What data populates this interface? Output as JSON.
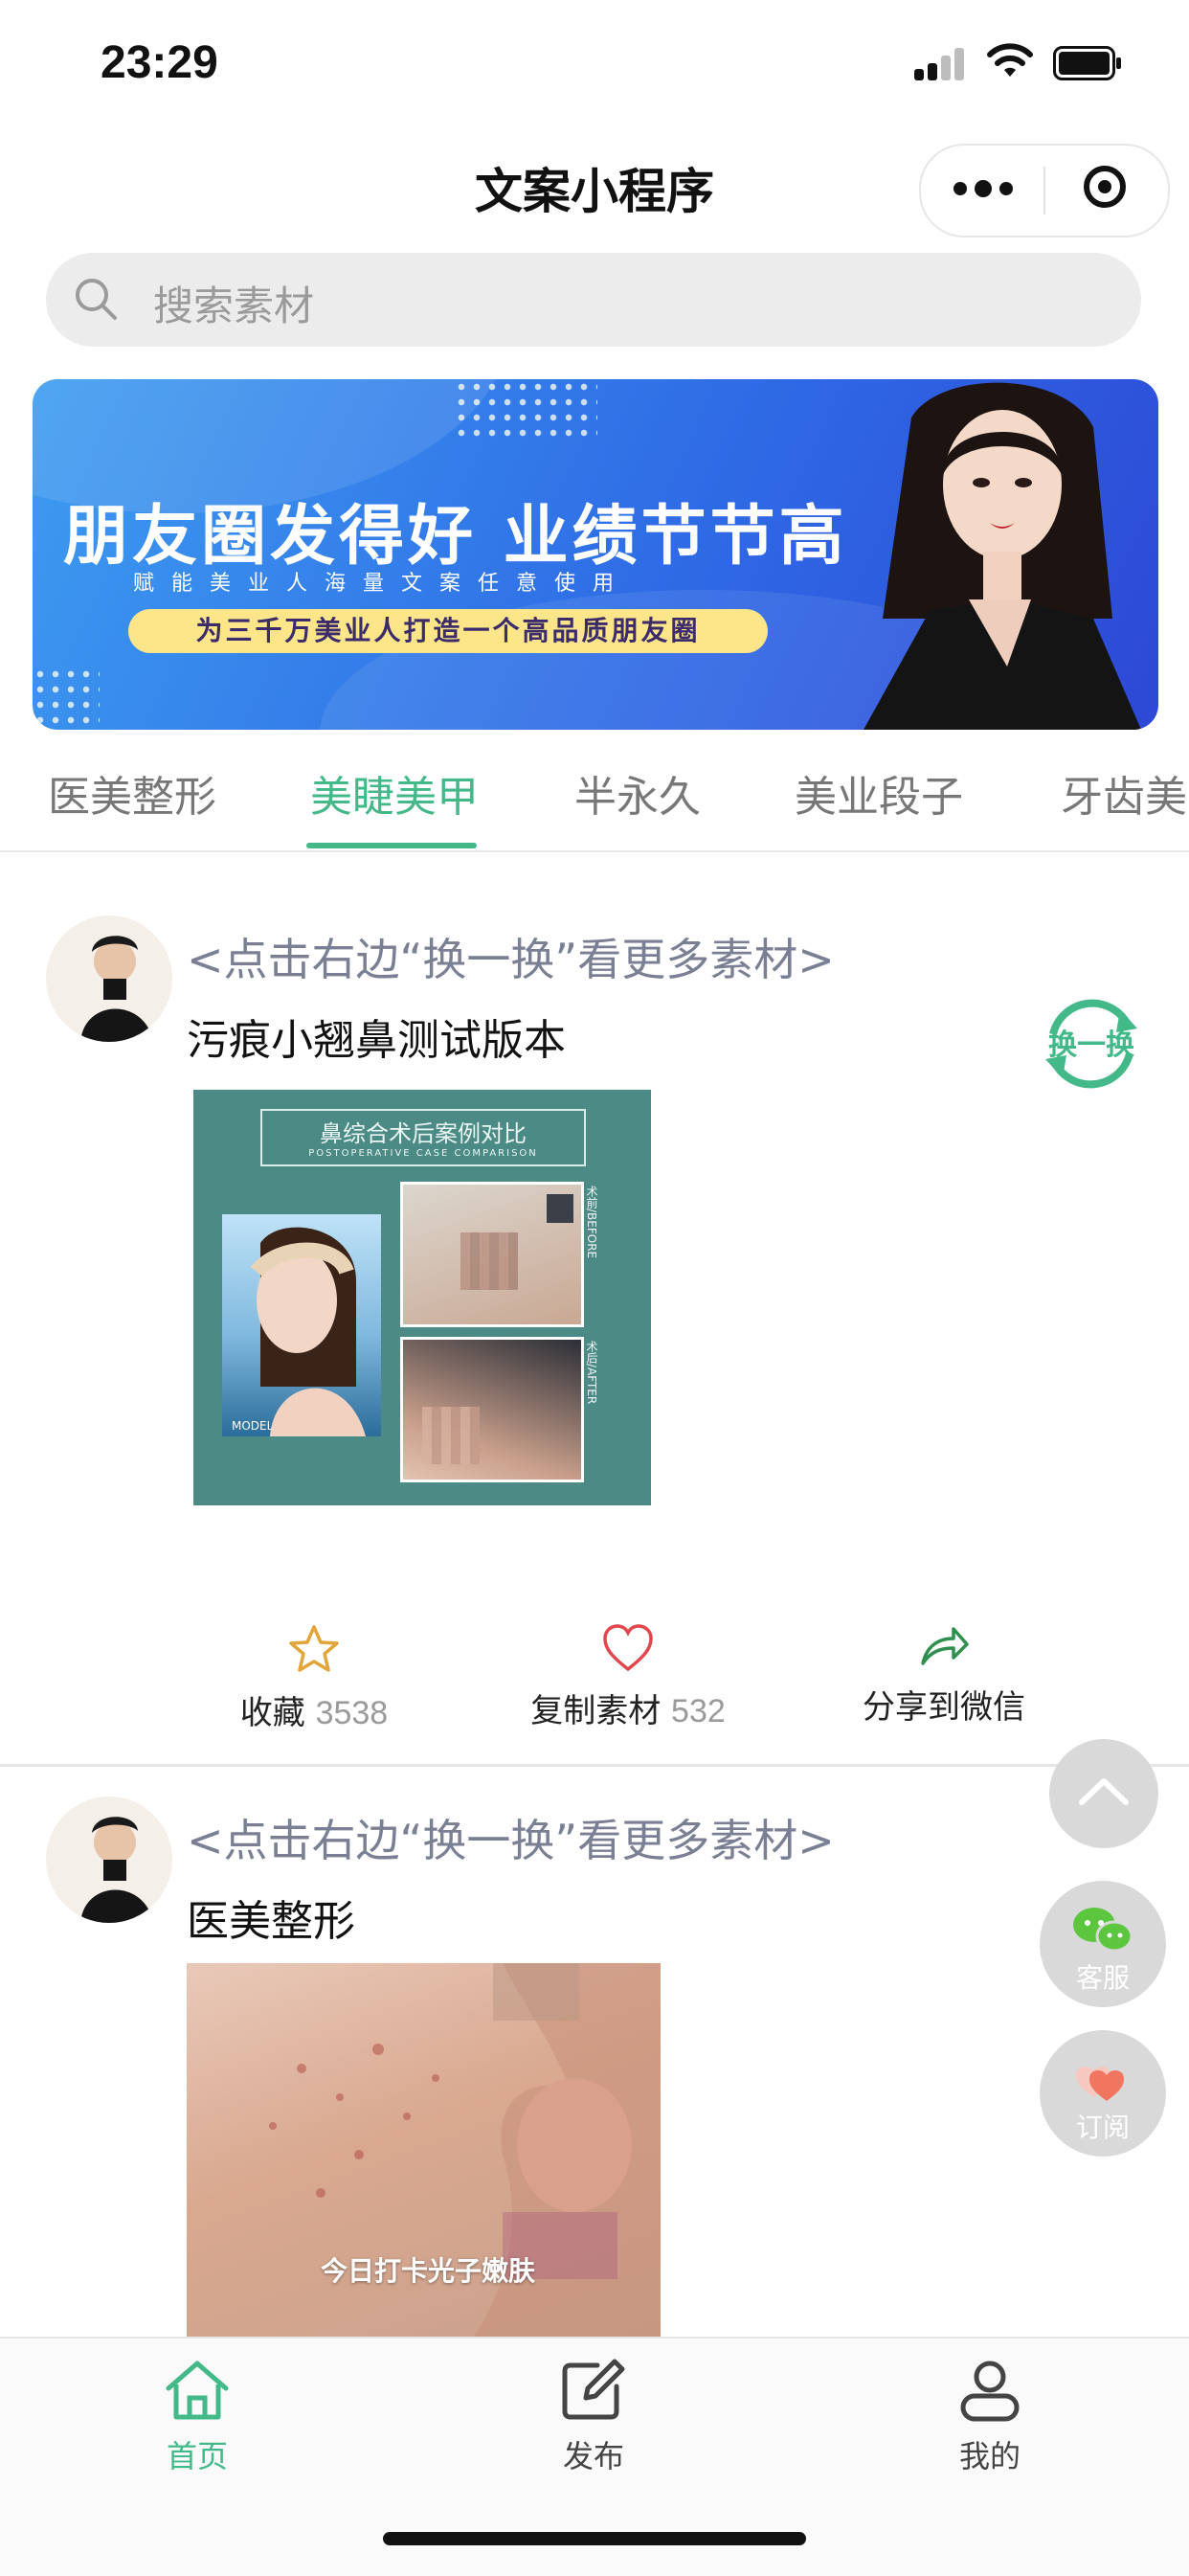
{
  "status_bar": {
    "time": "23:29"
  },
  "nav": {
    "title": "文案小程序"
  },
  "search": {
    "placeholder": "搜索素材"
  },
  "banner": {
    "headline": "朋友圈发得好  业绩节节高",
    "subline": "赋能美业人海量文案任意使用",
    "pill": "为三千万美业人打造一个高品质朋友圈"
  },
  "tabs": [
    {
      "label": "医美整形",
      "active": false
    },
    {
      "label": "美睫美甲",
      "active": true
    },
    {
      "label": "半永久",
      "active": false
    },
    {
      "label": "美业段子",
      "active": false
    },
    {
      "label": "牙齿美",
      "active": false
    }
  ],
  "posts": [
    {
      "hint": "<点击右边“换一换”看更多素材>",
      "title": "污痕小翘鼻测试版本",
      "image": {
        "header": "鼻综合术后案例对比",
        "header_en": "POSTOPERATIVE CASE COMPARISON",
        "before_label": "术前/BEFORE",
        "after_label": "术后/AFTER",
        "model_label": "MODEL"
      },
      "actions": {
        "favorite_label": "收藏",
        "favorite_count": "3538",
        "copy_label": "复制素材",
        "copy_count": "532",
        "share_label": "分享到微信"
      }
    },
    {
      "hint": "<点击右边“换一换”看更多素材>",
      "title": "医美整形",
      "image": {
        "caption": "今日打卡光子嫩肤"
      }
    }
  ],
  "swap_button": {
    "label": "换一换"
  },
  "float_buttons": {
    "service": "客服",
    "subscribe": "订阅"
  },
  "tabbar": {
    "home": "首页",
    "publish": "发布",
    "mine": "我的"
  },
  "colors": {
    "accent": "#43b98a",
    "hint": "#7a7f93",
    "fab": "#d9d9d9"
  }
}
